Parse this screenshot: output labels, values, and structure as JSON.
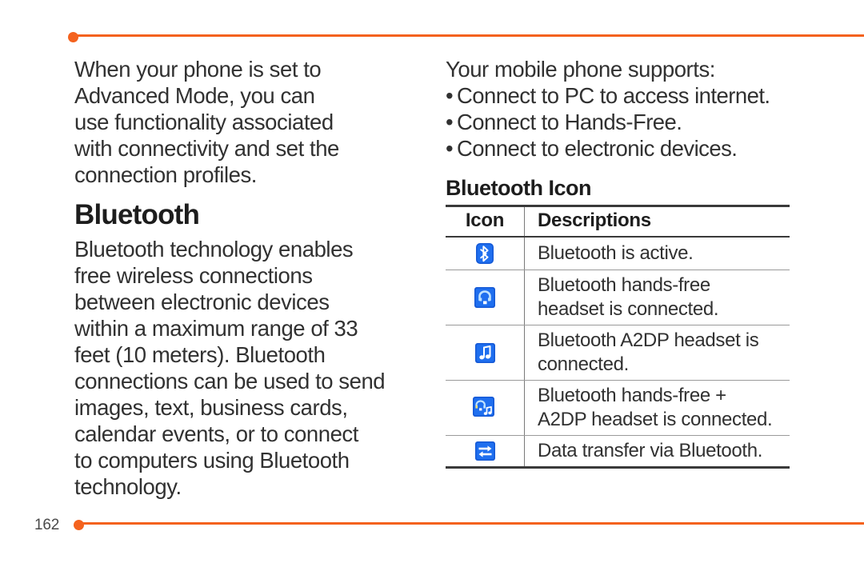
{
  "page": {
    "number": "162",
    "accent_color": "#F4621E",
    "icon_color": "#1559D6",
    "text_color": "#313131"
  },
  "left_column": {
    "intro_lines": [
      "When your phone is set to",
      "Advanced Mode, you can",
      "use functionality associated",
      "with connectivity and set the",
      "connection profiles."
    ],
    "section_title": "Bluetooth",
    "body_lines": [
      "Bluetooth technology enables",
      "free wireless connections",
      "between electronic devices",
      "within a maximum range of 33",
      "feet (10 meters). Bluetooth",
      "connections can be used to send",
      "images, text, business cards,",
      "calendar events, or to connect",
      "to computers using Bluetooth",
      "technology."
    ]
  },
  "right_column": {
    "supports_intro": "Your mobile phone supports:",
    "bullet_marker": "•",
    "bullets": [
      "Connect to PC to access internet.",
      "Connect to Hands-Free.",
      "Connect to electronic devices."
    ],
    "table_title": "Bluetooth Icon",
    "table": {
      "headers": [
        "Icon",
        "Descriptions"
      ],
      "rows": [
        {
          "icon_name": "bluetooth-active-icon",
          "description_lines": [
            "Bluetooth is active."
          ]
        },
        {
          "icon_name": "bluetooth-handsfree-headset-icon",
          "description_lines": [
            "Bluetooth hands-free",
            "headset is connected."
          ]
        },
        {
          "icon_name": "bluetooth-a2dp-headset-icon",
          "description_lines": [
            "Bluetooth A2DP headset is",
            "connected."
          ]
        },
        {
          "icon_name": "bluetooth-handsfree-a2dp-icon",
          "description_lines": [
            "Bluetooth hands-free +",
            "A2DP headset is connected."
          ]
        },
        {
          "icon_name": "bluetooth-data-transfer-icon",
          "description_lines": [
            "Data transfer via Bluetooth."
          ]
        }
      ]
    }
  }
}
